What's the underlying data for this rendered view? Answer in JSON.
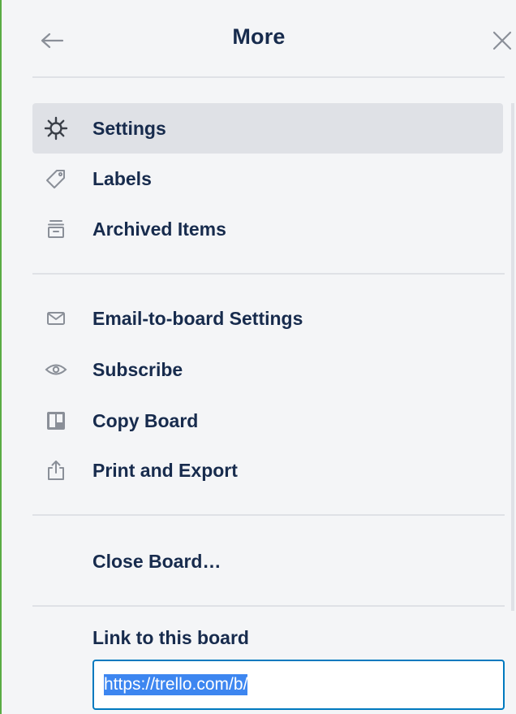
{
  "header": {
    "title": "More",
    "back_icon": "arrow-left-icon",
    "close_icon": "close-icon"
  },
  "menu": {
    "section1": [
      {
        "label": "Settings",
        "icon": "gear-icon",
        "active": true
      },
      {
        "label": "Labels",
        "icon": "tag-icon",
        "active": false
      },
      {
        "label": "Archived Items",
        "icon": "archive-icon",
        "active": false
      }
    ],
    "section2": [
      {
        "label": "Email-to-board Settings",
        "icon": "mail-icon"
      },
      {
        "label": "Subscribe",
        "icon": "eye-icon"
      },
      {
        "label": "Copy Board",
        "icon": "board-icon"
      },
      {
        "label": "Print and Export",
        "icon": "share-icon"
      }
    ],
    "close_board": "Close Board…"
  },
  "link_section": {
    "label": "Link to this board",
    "value": "https://trello.com/b/"
  },
  "colors": {
    "panel_bg": "#f4f5f7",
    "active_bg": "#dfe1e6",
    "text": "#172b4d",
    "icon": "#6b778c",
    "input_border": "#0079bf",
    "selection": "#3d86f0"
  }
}
